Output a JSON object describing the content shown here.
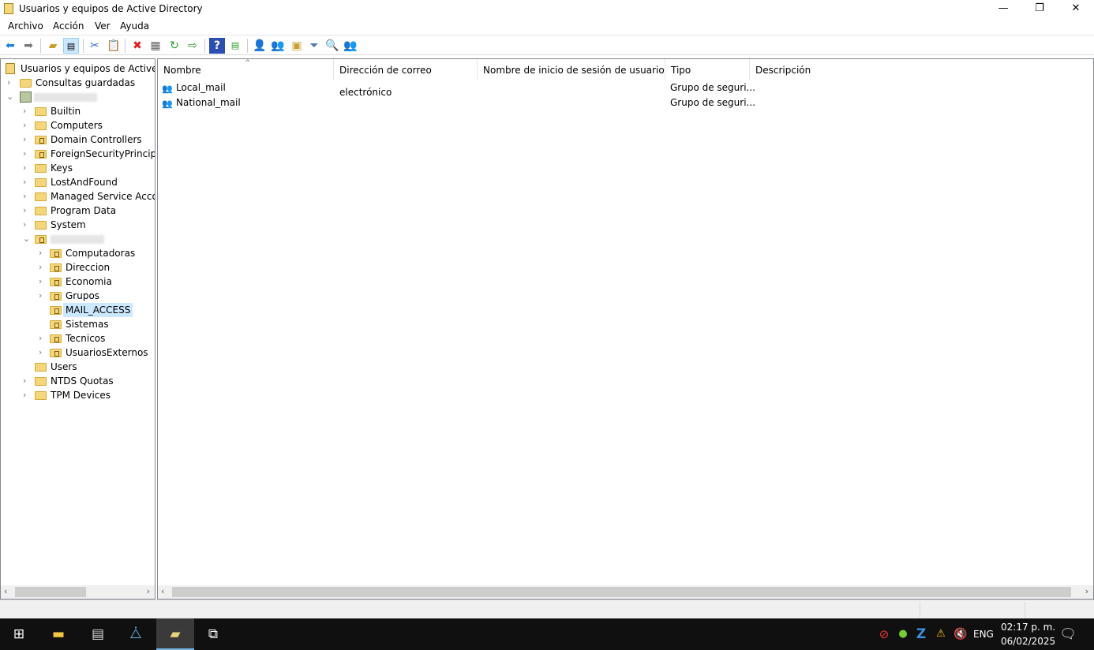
{
  "window": {
    "title": "Usuarios y equipos de Active Directory",
    "minimize": "—",
    "maximize": "❐",
    "close": "✕"
  },
  "menu": [
    "Archivo",
    "Acción",
    "Ver",
    "Ayuda"
  ],
  "toolbar": [
    "back",
    "forward",
    "up-folder",
    "show-hide-tree",
    "cut",
    "paste",
    "delete",
    "properties",
    "refresh",
    "export-list",
    "help",
    "show-action-pane",
    "new-user",
    "new-group",
    "new-ou",
    "filter",
    "find",
    "add-to-group"
  ],
  "tree": {
    "root": "Usuarios y equipos de Active Directory",
    "saved": "Consultas guardadas",
    "domain_children": [
      "Builtin",
      "Computers",
      "Domain Controllers",
      "ForeignSecurityPrincipals",
      "Keys",
      "LostAndFound",
      "Managed Service Accounts",
      "Program Data",
      "System"
    ],
    "ou_children": [
      "Computadoras",
      "Direccion",
      "Economia",
      "Grupos",
      "MAIL_ACCESS",
      "Sistemas",
      "Tecnicos",
      "UsuariosExternos"
    ],
    "after": [
      "Users",
      "NTDS Quotas",
      "TPM Devices"
    ],
    "selected": "MAIL_ACCESS"
  },
  "list": {
    "columns": [
      "Nombre",
      "Dirección de correo electrónico",
      "Nombre de inicio de sesión de usuario",
      "Tipo",
      "Descripción"
    ],
    "rows": [
      {
        "name": "Local_mail",
        "email": "",
        "logon": "",
        "type": "Grupo de seguri...",
        "desc": ""
      },
      {
        "name": "National_mail",
        "email": "",
        "logon": "",
        "type": "Grupo de seguri...",
        "desc": ""
      }
    ]
  },
  "taskbar": {
    "lang": "ENG",
    "time": "02:17 p. m.",
    "date": "06/02/2025"
  }
}
